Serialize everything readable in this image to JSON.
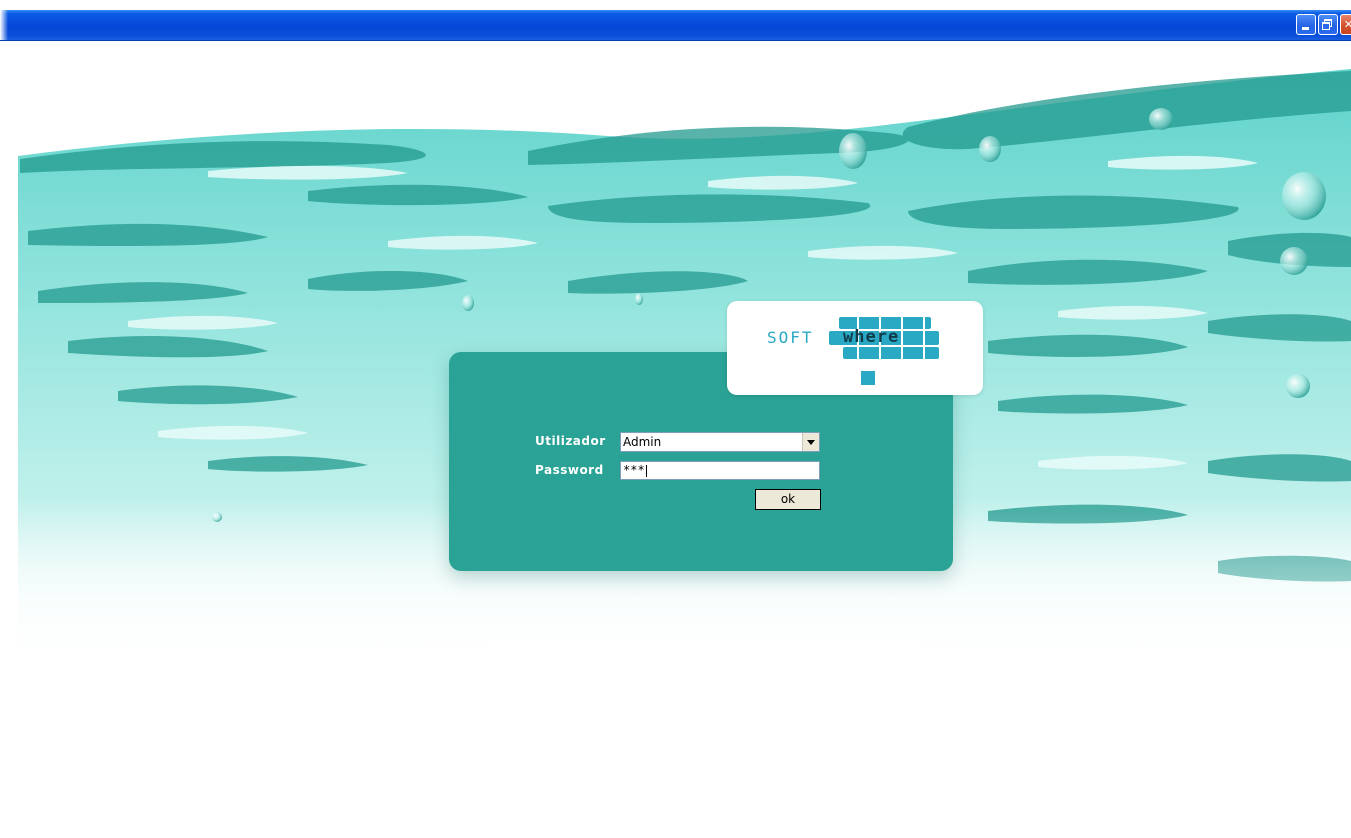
{
  "window": {
    "titlebar_color": "#0647d8",
    "controls": [
      "minimize",
      "restore",
      "close"
    ]
  },
  "login": {
    "user_label": "Utilizador",
    "user_value": "Admin",
    "password_label": "Password",
    "password_value": "***",
    "ok_label": "ok",
    "panel_color": "#2aa396"
  },
  "logo": {
    "text_soft": "SOFT",
    "text_where": "where",
    "brand_color": "#2aa9c5"
  }
}
